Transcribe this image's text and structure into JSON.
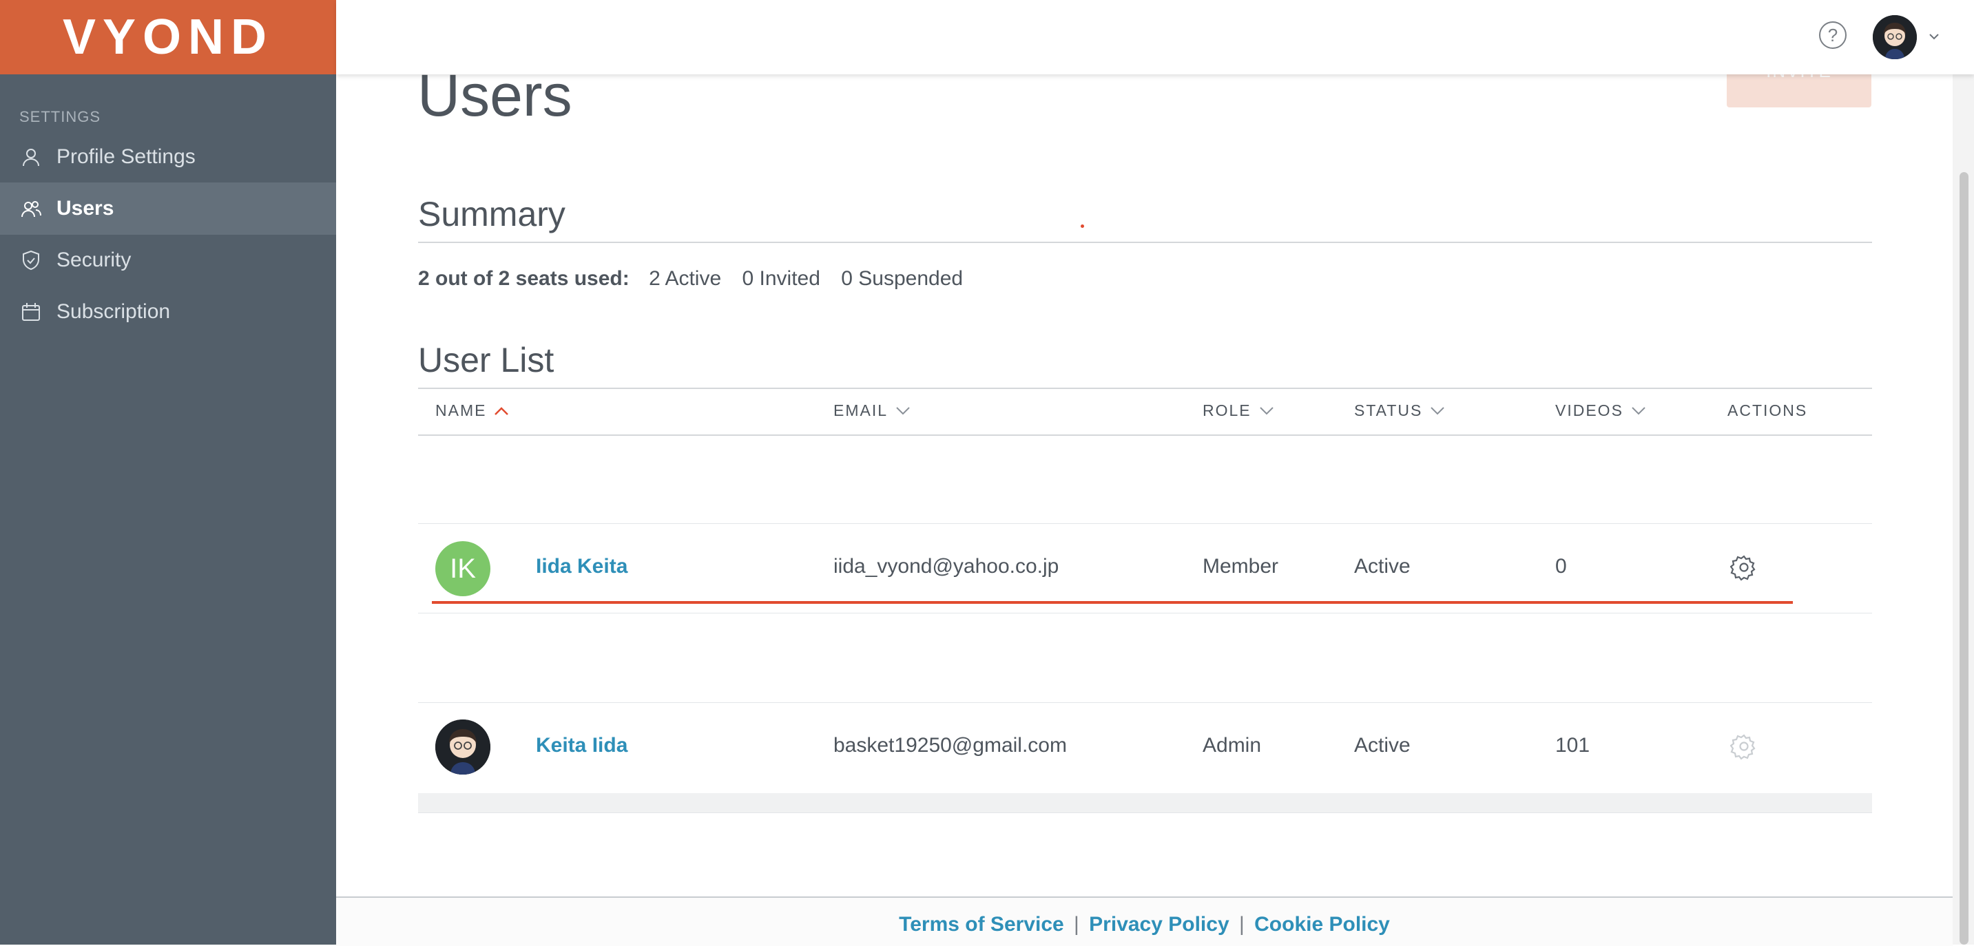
{
  "brand": {
    "logo_text": "VYOND",
    "color": "#d5623a"
  },
  "sidebar": {
    "section_label": "SETTINGS",
    "items": [
      {
        "label": "Profile Settings",
        "icon": "person-icon",
        "active": false
      },
      {
        "label": "Users",
        "icon": "users-icon",
        "active": true
      },
      {
        "label": "Security",
        "icon": "shield-icon",
        "active": false
      },
      {
        "label": "Subscription",
        "icon": "calendar-icon",
        "active": false
      }
    ]
  },
  "header": {
    "help_icon": "question-circle-icon",
    "help_glyph": "?",
    "avatar": "user-avatar",
    "menu_icon": "chevron-down-icon"
  },
  "page": {
    "title": "Users",
    "invite_label": "INVITE"
  },
  "summary": {
    "heading": "Summary",
    "seats_text": "2 out of 2 seats used:",
    "active": "2 Active",
    "invited": "0 Invited",
    "suspended": "0 Suspended"
  },
  "user_list": {
    "heading": "User List",
    "columns": [
      "NAME",
      "EMAIL",
      "ROLE",
      "STATUS",
      "VIDEOS",
      "ACTIONS"
    ],
    "rows": [
      {
        "initials": "IK",
        "name": "Iida Keita",
        "email": "iida_vyond@yahoo.co.jp",
        "role": "Member",
        "status": "Active",
        "videos": "0"
      },
      {
        "initials": "",
        "name": "Keita Iida",
        "email": "basket19250@gmail.com",
        "role": "Admin",
        "status": "Active",
        "videos": "101"
      }
    ]
  },
  "footer": {
    "terms": "Terms of Service",
    "privacy": "Privacy Policy",
    "cookie": "Cookie Policy",
    "separator": "|"
  },
  "colors": {
    "accent": "#d5623a",
    "link": "#2e8fb8",
    "sidebar_bg": "#535f6a",
    "highlight": "#e14b2f"
  }
}
